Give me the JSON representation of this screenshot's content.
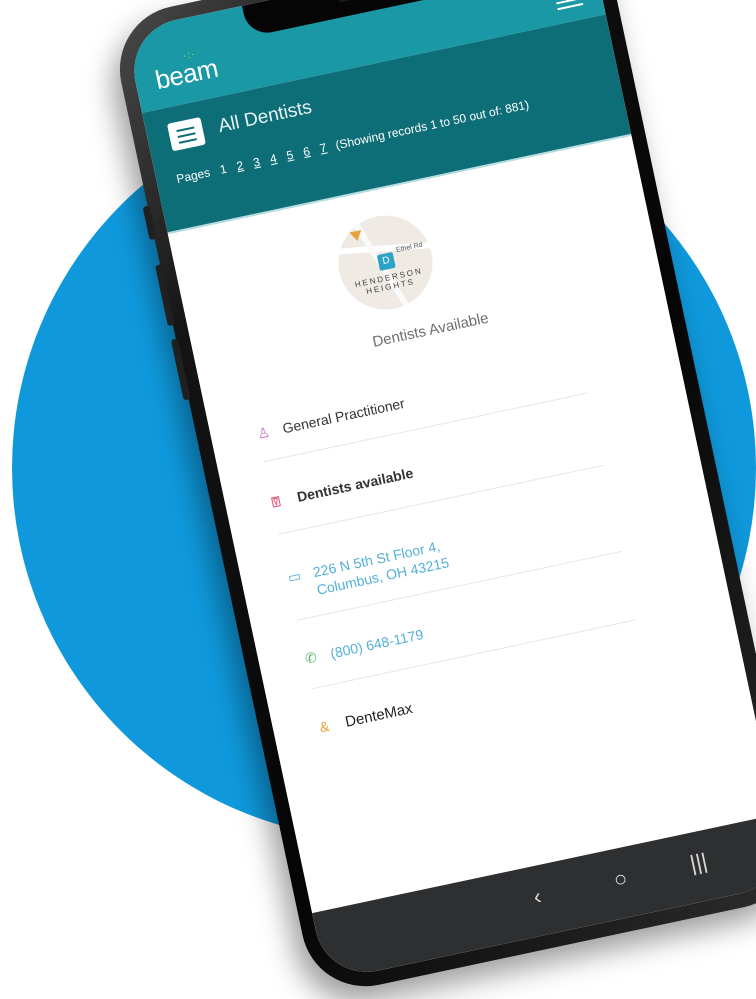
{
  "app": {
    "logo": "beam",
    "colors": {
      "header": "#1a98a6",
      "subheader": "#0e6e77",
      "background_circle": "#0f99dc",
      "link": "#52b0d6"
    }
  },
  "header": {
    "menu_icon": "hamburger-icon"
  },
  "subheader": {
    "title": "All Dentists",
    "pages_label": "Pages",
    "pages": [
      "1",
      "2",
      "3",
      "4",
      "5",
      "6",
      "7"
    ],
    "current_page": "1",
    "records_text": "(Showing records 1 to 50 out of: 881)"
  },
  "detail": {
    "map": {
      "road_label": "Ethel Rd",
      "pin_label": "D",
      "area_name": "HENDERSON HEIGHTS"
    },
    "availability_heading": "Dentists Available",
    "specialty": {
      "icon": "person-icon",
      "label": "General Practitioner"
    },
    "availability": {
      "icon": "tooth-icon",
      "label": "Dentists available"
    },
    "address": {
      "icon": "map-icon",
      "line1": "226 N 5th St Floor 4,",
      "line2": "Columbus, OH 43215"
    },
    "phone": {
      "icon": "phone-icon",
      "label": "(800) 648-1179"
    },
    "network": {
      "icon": "network-icon",
      "label": "DenteMax"
    }
  },
  "system_nav": {
    "back": "‹",
    "home": "○",
    "recents": "|||"
  }
}
